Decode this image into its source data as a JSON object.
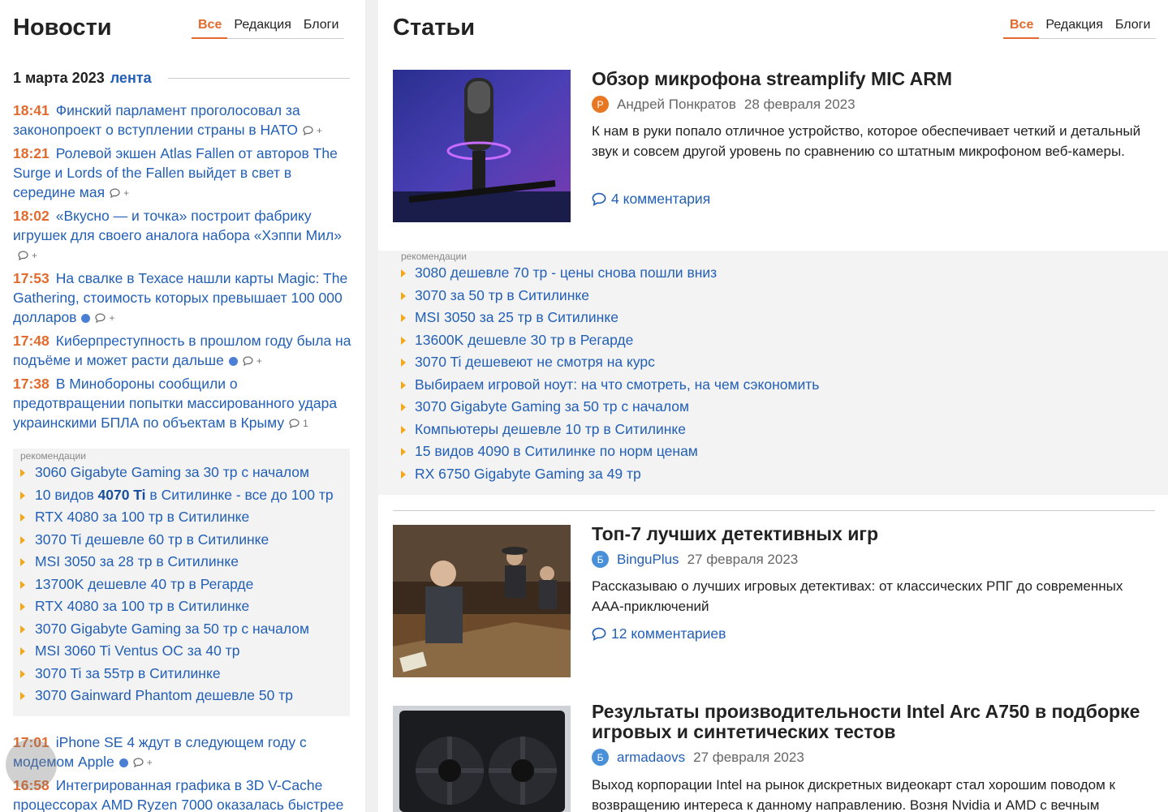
{
  "news": {
    "title": "Новости",
    "tabs": [
      {
        "label": "Все",
        "active": true
      },
      {
        "label": "Редакция"
      },
      {
        "label": "Блоги"
      }
    ],
    "date": "1 марта 2023",
    "feed_link": "лента",
    "items": [
      {
        "time": "18:41",
        "title": "Финский парламент проголосовал за законопроект о вступлении страны в НАТО",
        "comments": "+"
      },
      {
        "time": "18:21",
        "title": "Ролевой экшен Atlas Fallen от авторов The Surge и Lords of the Fallen выйдет в свет в середине мая",
        "comments": "+"
      },
      {
        "time": "18:02",
        "title": "«Вкусно — и точка» построит фабрику игрушек для своего аналога набора «Хэппи Мил»",
        "comments": "+"
      },
      {
        "time": "17:53",
        "title": "На свалке в Техасе нашли карты Magic: The Gathering, стоимость которых превышает 100 000 долларов",
        "comments": "+"
      },
      {
        "time": "17:48",
        "title": "Киберпреступность в прошлом году была на подъёме и может расти дальше",
        "comments": "+"
      },
      {
        "time": "17:38",
        "title": "В Минобороны сообщили о предотвращении попытки массированного удара украинскими БПЛА по объектам в Крыму",
        "comments": "1"
      },
      {
        "time": "17:01",
        "title": "iPhone SE 4 ждут в следующем году с модемом Apple",
        "comments": "+"
      },
      {
        "time": "16:58",
        "title": "Интегрированная графика в 3D V-Cache процессорах AMD Ryzen 7000 оказалась быстрее",
        "comments": ""
      }
    ],
    "recommendations": {
      "caption": "рекомендации",
      "items": [
        "3060 Gigabyte Gaming за 30 тр с началом",
        {
          "pre": "10 видов ",
          "bold": "4070 Ti",
          "post": " в Ситилинке - все до 100 тр"
        },
        "RTX 4080 за 100 тр в Ситилинке",
        "3070 Ti дешевле 60 тр в Ситилинке",
        "MSI 3050 за 28 тр в Ситилинке",
        "13700K дешевле 40 тр в Регарде",
        "RTX 4080 за 100 тр в Ситилинке",
        "3070 Gigabyte Gaming за 50 тр с началом",
        "MSI 3060 Ti Ventus OC за 40 тр",
        "3070 Ti за 55тр в Ситилинке",
        "3070 Gainward Phantom дешевле 50 тр"
      ]
    }
  },
  "articles": {
    "title": "Статьи",
    "tabs": [
      {
        "label": "Все",
        "active": true
      },
      {
        "label": "Редакция"
      },
      {
        "label": "Блоги"
      }
    ],
    "items": [
      {
        "title": "Обзор микрофона streamplify MIC ARM",
        "avatar_letter": "Р",
        "avatar_color": "#e87722",
        "author": "Андрей Понкратов",
        "author_link": false,
        "date": "28 февраля 2023",
        "description": "К нам в руки попало отличное устройство, которое обеспечивает четкий и детальный звук и совсем другой уровень по сравнению со штатным микрофоном веб-камеры.",
        "comments": "4 комментария",
        "image": "microphone"
      },
      {
        "title": "Топ-7 лучших детективных игр",
        "avatar_letter": "Б",
        "avatar_color": "#4a90d9",
        "author": "BinguPlus",
        "author_link": true,
        "date": "27 февраля 2023",
        "description": "Рассказываю о лучших игровых детективах: от классических РПГ до современных ААА-приключений",
        "comments": "12 комментариев",
        "image": "detective-game-scene"
      },
      {
        "title": "Результаты производительности Intel Arc A750 в подборке игровых и синтетических тестов",
        "avatar_letter": "Б",
        "avatar_color": "#4a90d9",
        "author": "armadaovs",
        "author_link": true,
        "date": "27 февраля 2023",
        "description": "Выход корпорации Intel на рынок дискретных видеокарт стал хорошим поводом к возвращению интереса к данному направлению. Возня Nvidia и AMD с вечным",
        "comments": "",
        "image": "graphics-card"
      }
    ],
    "recommendations": {
      "caption": "рекомендации",
      "items": [
        "3080 дешевле 70 тр - цены снова пошли вниз",
        "3070 за 50 тр в Ситилинке",
        "MSI 3050 за 25 тр в Ситилинке",
        "13600K дешевле 30 тр в Регарде",
        "3070 Ti дешевеют не смотря на курс",
        "Выбираем игровой ноут: на что смотреть, на чем сэкономить",
        "3070 Gigabyte Gaming за 50 тр с началом",
        "Компьютеры дешевле 10 тр в Ситилинке",
        "15 видов 4090 в Ситилинке по норм ценам",
        "RX 6750 Gigabyte Gaming за 49 тр"
      ]
    }
  },
  "colors": {
    "accent": "#e26a2c",
    "link": "#225fb5",
    "bullet": "#f3a81b",
    "rec_bg": "#f3f3f3"
  }
}
